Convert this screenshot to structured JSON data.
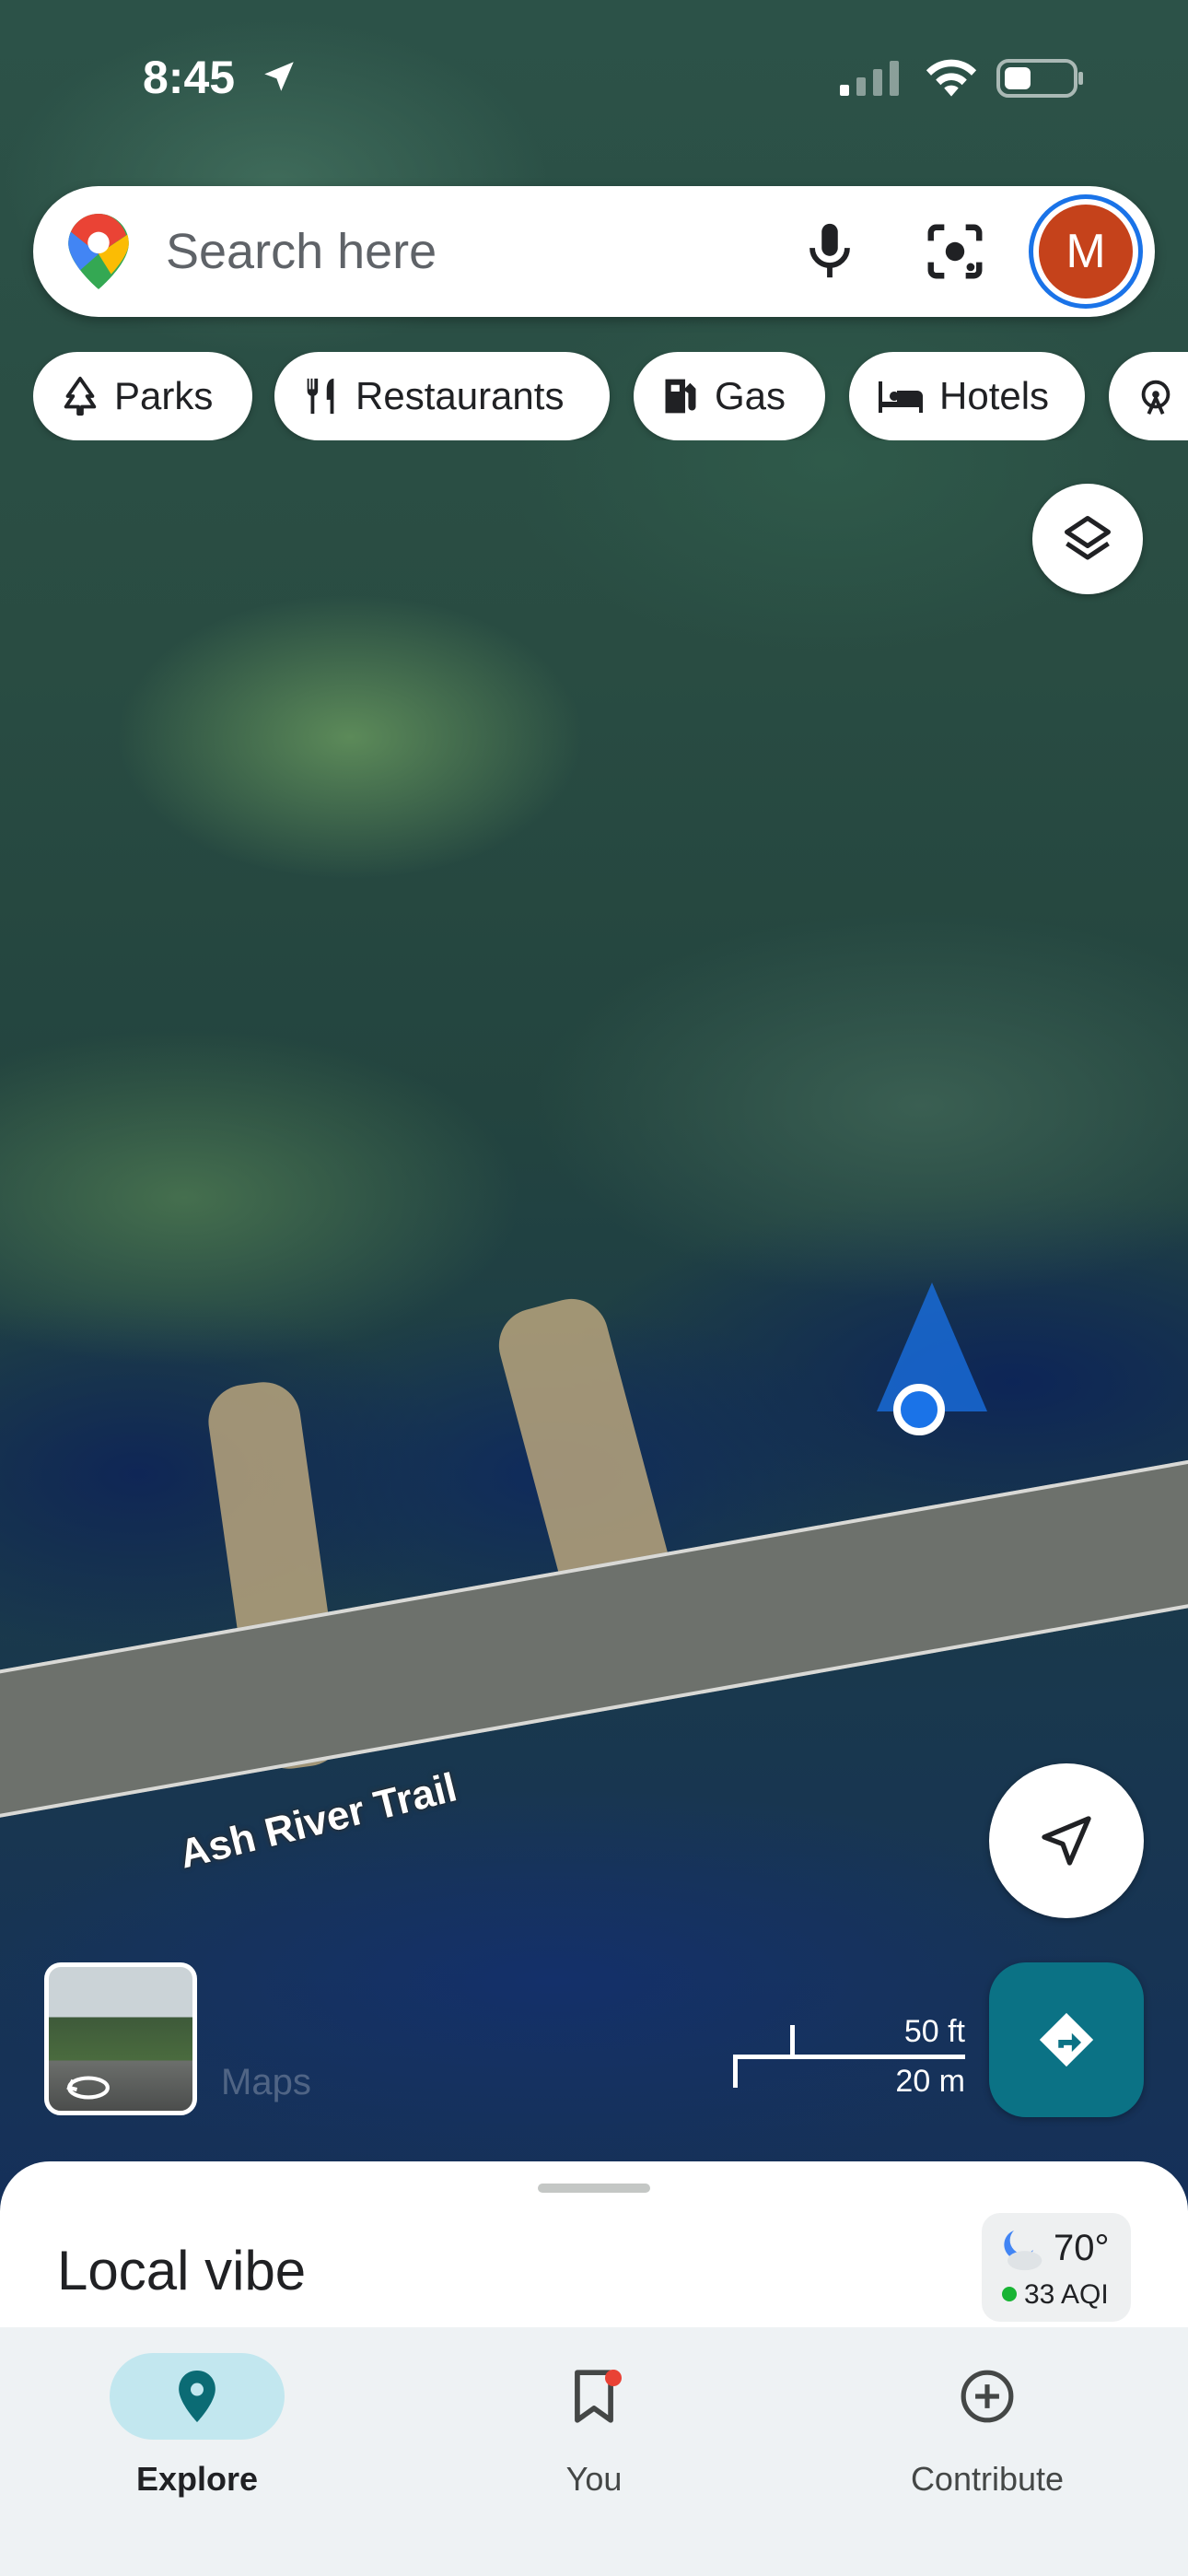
{
  "status_bar": {
    "time": "8:45"
  },
  "search": {
    "placeholder": "Search here",
    "avatar_initial": "M"
  },
  "chips": [
    {
      "label": "Parks",
      "icon": "tree-icon"
    },
    {
      "label": "Restaurants",
      "icon": "fork-knife-icon"
    },
    {
      "label": "Gas",
      "icon": "gas-pump-icon"
    },
    {
      "label": "Hotels",
      "icon": "bed-icon"
    },
    {
      "label": "",
      "icon": "ferris-wheel-icon"
    }
  ],
  "map": {
    "road_label": "Ash River Trail",
    "scale_imperial": "50 ft",
    "scale_metric": "20 m",
    "watermark": "Maps"
  },
  "sheet": {
    "title": "Local vibe",
    "weather": {
      "temperature": "70°",
      "aqi": "33 AQI"
    }
  },
  "nav": [
    {
      "label": "Explore",
      "icon": "location-pin-icon",
      "active": true
    },
    {
      "label": "You",
      "icon": "bookmark-icon",
      "active": false
    },
    {
      "label": "Contribute",
      "icon": "add-circle-icon",
      "active": false
    }
  ],
  "colors": {
    "accent": "#1a73e8",
    "directions": "#0b7285",
    "avatar": "#c5421b",
    "nav_active_pill": "#c2e7ef"
  }
}
